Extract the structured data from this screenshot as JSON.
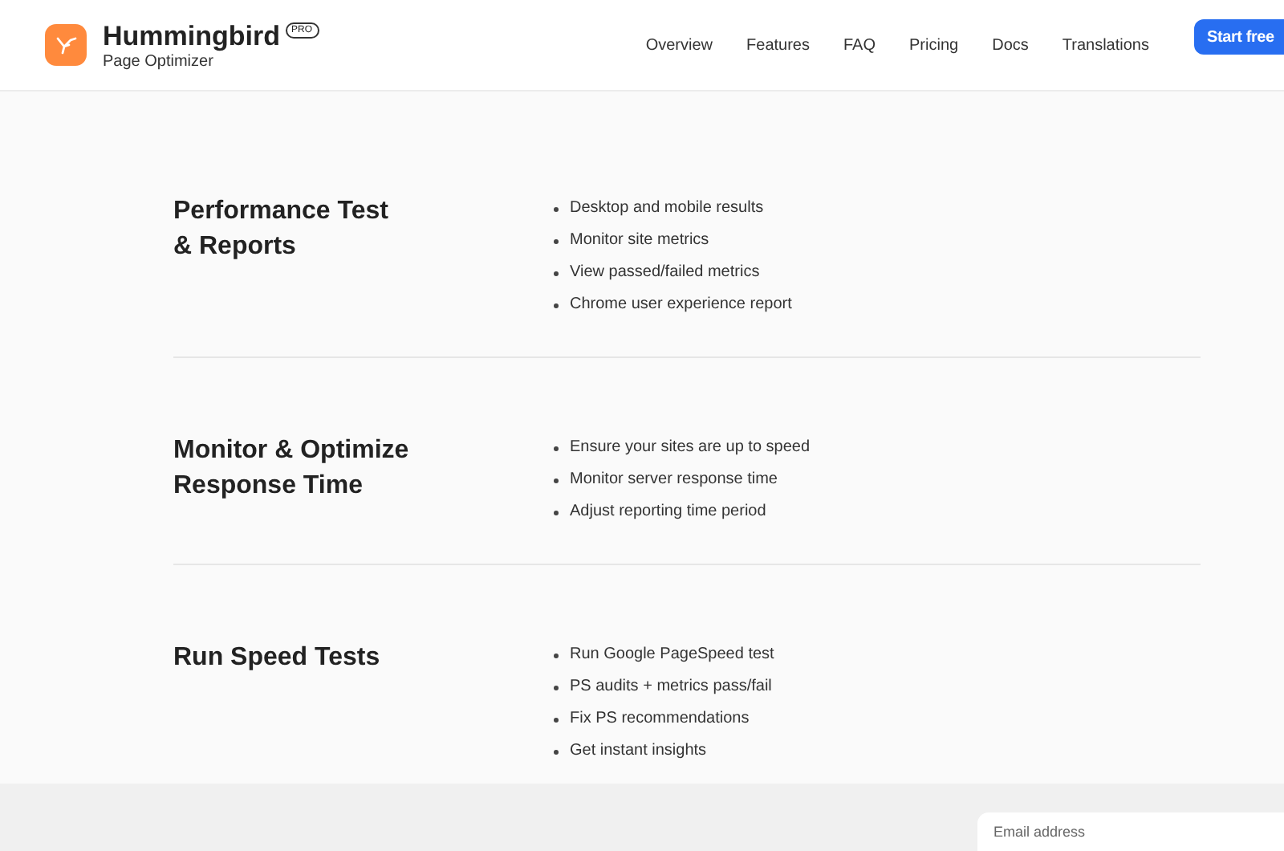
{
  "brand": {
    "name": "Hummingbird",
    "badge": "PRO",
    "tagline": "Page Optimizer"
  },
  "nav": [
    {
      "label": "Overview"
    },
    {
      "label": "Features"
    },
    {
      "label": "FAQ"
    },
    {
      "label": "Pricing"
    },
    {
      "label": "Docs"
    },
    {
      "label": "Translations"
    }
  ],
  "cta": "Start free",
  "features": [
    {
      "title_lines": [
        "Performance Test",
        "& Reports"
      ],
      "bullets": [
        "Desktop and mobile results",
        "Monitor site metrics",
        "View passed/failed metrics",
        "Chrome user experience report"
      ]
    },
    {
      "title_lines": [
        "Monitor & Optimize",
        "Response Time"
      ],
      "bullets": [
        "Ensure your sites are up to speed",
        "Monitor server response time",
        "Adjust reporting time period"
      ]
    },
    {
      "title_lines": [
        "Run Speed Tests"
      ],
      "bullets": [
        "Run Google PageSpeed test",
        "PS audits + metrics pass/fail",
        "Fix PS recommendations",
        "Get instant insights"
      ]
    }
  ],
  "footer": {
    "email": {
      "placeholder": "Email address"
    }
  }
}
